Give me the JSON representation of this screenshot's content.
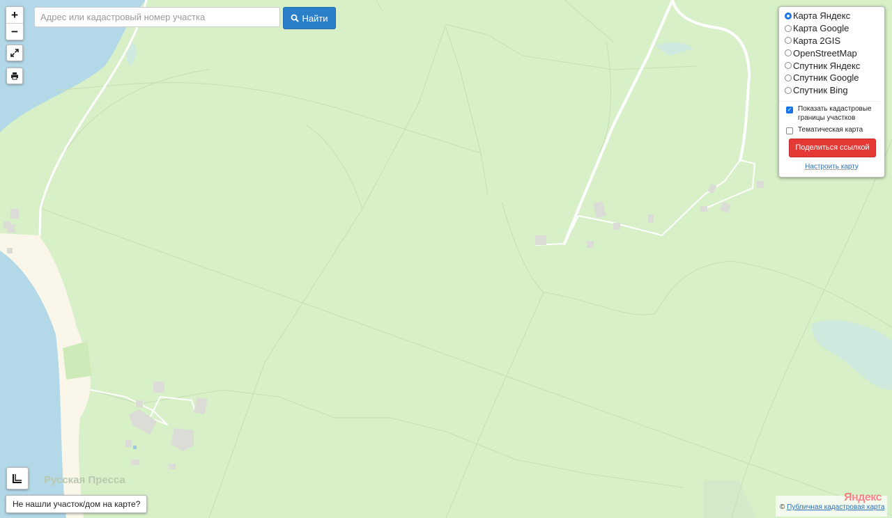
{
  "search": {
    "placeholder": "Адрес или кадастровый номер участка",
    "button_label": "Найти"
  },
  "zoom": {
    "in_label": "+",
    "out_label": "−"
  },
  "layers": {
    "options": [
      {
        "label": "Карта Яндекс",
        "selected": true
      },
      {
        "label": "Карта Google",
        "selected": false
      },
      {
        "label": "Карта 2GIS",
        "selected": false
      },
      {
        "label": "OpenStreetMap",
        "selected": false
      },
      {
        "label": "Спутник Яндекс",
        "selected": false
      },
      {
        "label": "Спутник Google",
        "selected": false
      },
      {
        "label": "Спутник Bing",
        "selected": false
      }
    ],
    "show_cadastral_label": "Показать кадастровые границы участков",
    "show_cadastral_checked": true,
    "thematic_label": "Тематическая карта",
    "thematic_checked": false,
    "share_label": "Поделиться ссылкой",
    "setup_label": "Настроить карту"
  },
  "not_found_label": "Не нашли участок/дом на карте?",
  "map": {
    "place_label": "Русская Пресса",
    "colors": {
      "land": "#d8f0c8",
      "water": "#b3d8e8",
      "sand": "#faf6ea",
      "building": "#dcdcd6",
      "road": "#ffffff"
    }
  },
  "attribution": {
    "copyright": "©",
    "link_label": "Публичная кадастровая карта",
    "provider_logo": "Яндекс"
  },
  "icons": {
    "search": "search-icon",
    "fullscreen": "fullscreen-icon",
    "print": "print-icon",
    "ruler": "ruler-icon"
  }
}
